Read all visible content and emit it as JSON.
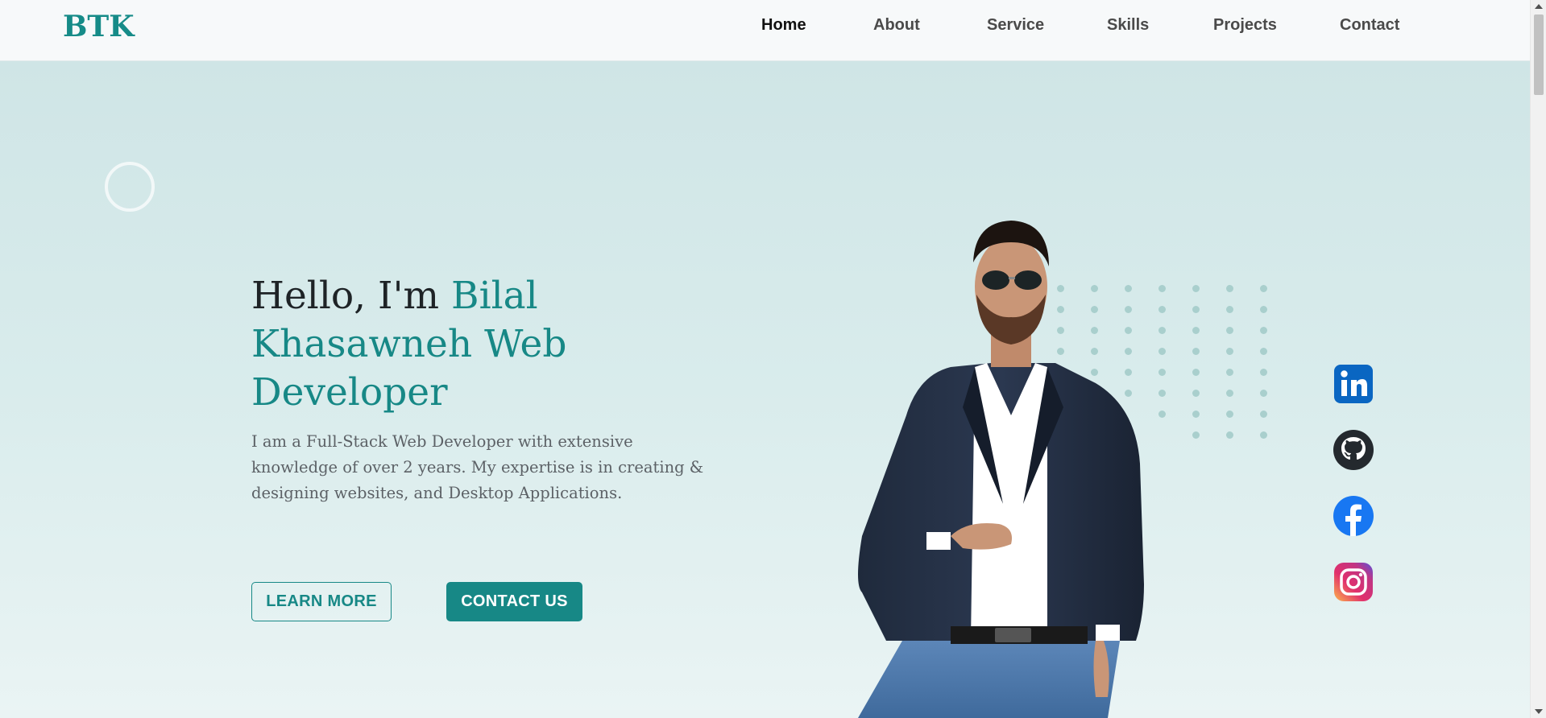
{
  "nav": {
    "logo": "BTK",
    "links": [
      {
        "label": "Home",
        "active": true
      },
      {
        "label": "About",
        "active": false
      },
      {
        "label": "Service",
        "active": false
      },
      {
        "label": "Skills",
        "active": false
      },
      {
        "label": "Projects",
        "active": false
      },
      {
        "label": "Contact",
        "active": false
      }
    ]
  },
  "hero": {
    "greeting": "Hello, I'm ",
    "name_line_1": "Bilal",
    "name_line_2": "Khasawneh Web",
    "name_line_3": "Developer",
    "description": "I am a Full-Stack Web Developer with extensive knowledge of over 2 years. My expertise is in creating & designing websites, and Desktop Applications.",
    "learn_more_label": "LEARN MORE",
    "contact_us_label": "CONTACT US"
  },
  "social": [
    {
      "name": "linkedin-icon",
      "color": "#0a66c2"
    },
    {
      "name": "github-icon",
      "color": "#24292e"
    },
    {
      "name": "facebook-icon",
      "color": "#1877f2"
    },
    {
      "name": "instagram-icon",
      "color": "#e1306c"
    }
  ],
  "colors": {
    "accent": "#178886",
    "hero_bg": "#d3e8e9",
    "text_dark": "#1e2326",
    "text_muted": "#5c6166"
  }
}
